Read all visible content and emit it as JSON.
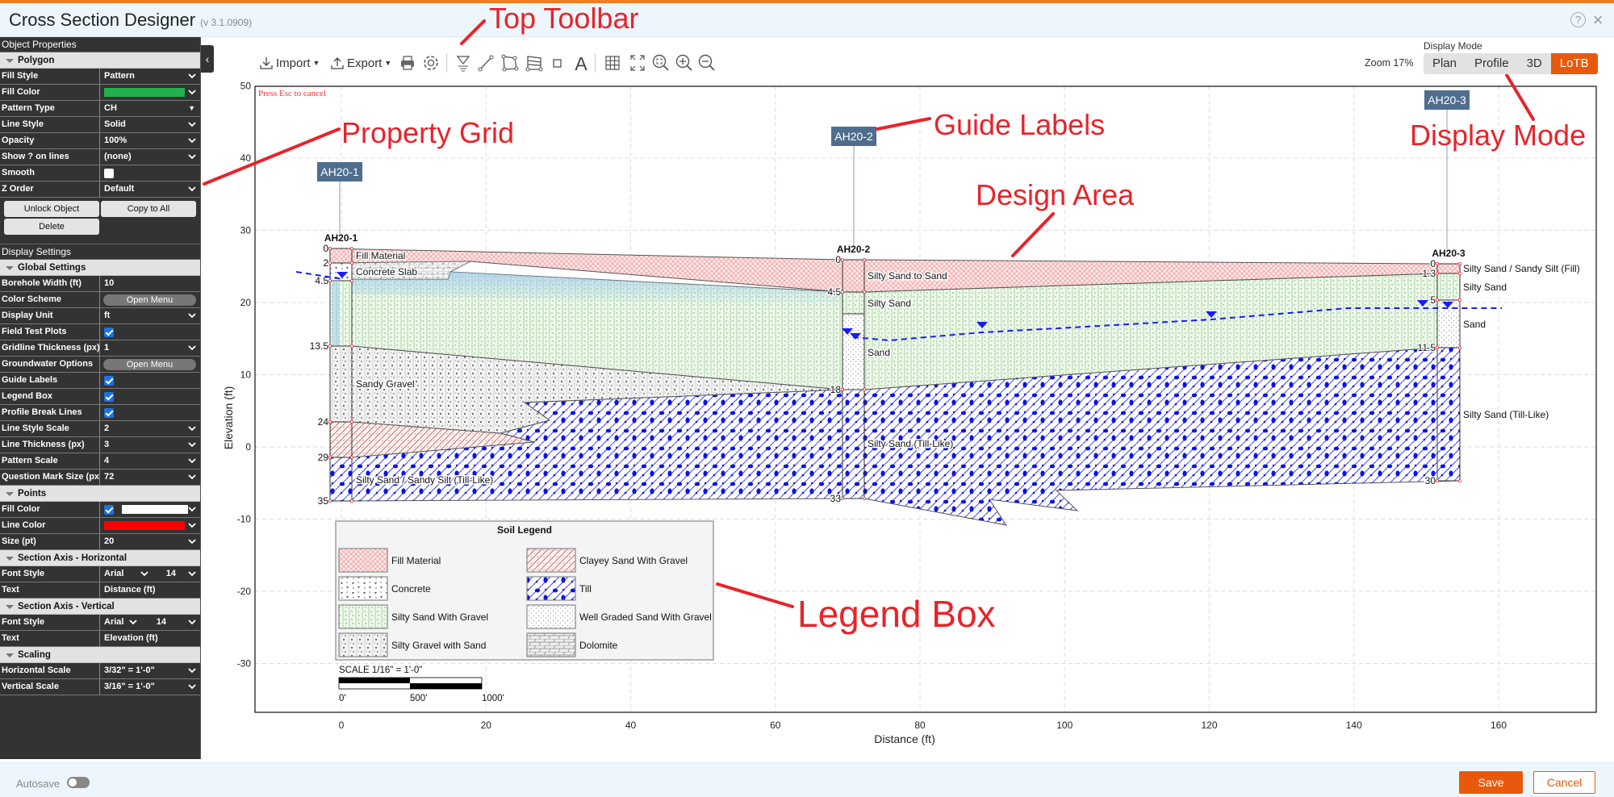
{
  "app": {
    "title": "Cross Section Designer",
    "version": "(v 3.1.0909)"
  },
  "header_icons": [
    "help-icon",
    "close-icon"
  ],
  "sidebar": {
    "sections": [
      {
        "header": "Object Properties"
      },
      {
        "group": "Polygon",
        "rows": [
          {
            "label": "Fill Style",
            "type": "select",
            "value": "Pattern"
          },
          {
            "label": "Fill Color",
            "type": "color",
            "color": "#22b14c"
          },
          {
            "label": "Pattern Type",
            "type": "caret",
            "value": "CH"
          },
          {
            "label": "Line Style",
            "type": "select",
            "value": "Solid"
          },
          {
            "label": "Opacity",
            "type": "select",
            "value": "100%"
          },
          {
            "label": "Show ? on lines",
            "type": "select",
            "value": "(none)"
          },
          {
            "label": "Smooth",
            "type": "checkbox",
            "checked": false
          },
          {
            "label": "Z Order",
            "type": "select",
            "value": "Default"
          }
        ]
      },
      {
        "buttons": [
          "Unlock Object",
          "Copy to All",
          "Delete"
        ]
      },
      {
        "header": "Display Settings"
      },
      {
        "group": "Global Settings",
        "rows": [
          {
            "label": "Borehole Width (ft)",
            "type": "text",
            "value": "10"
          },
          {
            "label": "Color Scheme",
            "type": "button",
            "value": "Open Menu"
          },
          {
            "label": "Display Unit",
            "type": "select",
            "value": "ft"
          },
          {
            "label": "Field Test Plots",
            "type": "checkbox",
            "checked": true
          },
          {
            "label": "Gridline Thickness (px)",
            "type": "select",
            "value": "1"
          },
          {
            "label": "Groundwater Options",
            "type": "button",
            "value": "Open Menu"
          },
          {
            "label": "Guide Labels",
            "type": "checkbox",
            "checked": true
          },
          {
            "label": "Legend Box",
            "type": "checkbox",
            "checked": true
          },
          {
            "label": "Profile Break Lines",
            "type": "checkbox",
            "checked": true
          },
          {
            "label": "Line Style Scale",
            "type": "select",
            "value": "2"
          },
          {
            "label": "Line Thickness (px)",
            "type": "select",
            "value": "3"
          },
          {
            "label": "Pattern Scale",
            "type": "select",
            "value": "4"
          },
          {
            "label": "Question Mark Size (px)",
            "type": "select",
            "value": "72"
          }
        ]
      },
      {
        "group": "Points",
        "rows": [
          {
            "label": "Fill Color",
            "type": "checkcolor",
            "checked": true,
            "color": "#ffffff"
          },
          {
            "label": "Line Color",
            "type": "color",
            "color": "#ff0000"
          },
          {
            "label": "Size (pt)",
            "type": "select",
            "value": "20"
          }
        ]
      },
      {
        "group": "Section Axis - Horizontal",
        "rows": [
          {
            "label": "Font Style",
            "type": "font",
            "value": "Arial",
            "size": "14"
          },
          {
            "label": "Text",
            "type": "text",
            "value": "Distance (ft)"
          }
        ]
      },
      {
        "group": "Section Axis - Vertical",
        "rows": [
          {
            "label": "Font Style",
            "type": "font",
            "value": "Arial",
            "size": "14"
          },
          {
            "label": "Text",
            "type": "text",
            "value": "Elevation (ft)"
          }
        ]
      },
      {
        "group": "Scaling",
        "rows": [
          {
            "label": "Horizontal Scale",
            "type": "select",
            "value": "3/32\" = 1'-0\""
          },
          {
            "label": "Vertical Scale",
            "type": "select",
            "value": "3/16\" = 1'-0\""
          }
        ]
      }
    ]
  },
  "toolbar": {
    "import_label": "Import",
    "export_label": "Export",
    "tools": [
      "print-icon",
      "settings-gear-icon",
      "groundwater-tool-icon",
      "line-tool-icon",
      "polygon-tool-icon",
      "layers-tool-icon",
      "rectangle-tool-icon",
      "text-tool-icon",
      "grid-icon",
      "fit-screen-icon",
      "zoom-extents-icon",
      "zoom-in-icon",
      "zoom-out-icon"
    ]
  },
  "zoom": "Zoom 17%",
  "display_mode": {
    "label": "Display Mode",
    "options": [
      "Plan",
      "Profile",
      "3D",
      "LoTB"
    ],
    "active": "LoTB",
    "accent": "#e8590c"
  },
  "design_area": {
    "notice": "Press Esc to cancel",
    "x_axis": {
      "label": "Distance (ft)",
      "ticks": [
        0,
        20,
        40,
        60,
        80,
        100,
        120,
        140,
        160
      ]
    },
    "y_axis": {
      "label": "Elevation (ft)",
      "ticks": [
        50,
        40,
        30,
        20,
        10,
        0,
        -10,
        -20,
        -30
      ]
    },
    "boreholes": [
      {
        "name": "AH20-1",
        "guide_label": "AH20-1",
        "depths": [
          "0",
          "2",
          "4.5",
          "13.5",
          "24",
          "29",
          "35"
        ],
        "layers": [
          "Fill Material",
          "Concrete Slab",
          "Sandy Gravel",
          "Silty Sand / Sandy Silt (Till-Like)"
        ]
      },
      {
        "name": "AH20-2",
        "guide_label": "AH20-2",
        "depths": [
          "0",
          "4.5",
          "18",
          "33"
        ],
        "layers": [
          "Silty Sand to Sand",
          "Silty Sand",
          "Sand",
          "Silty Sand (Till-Like)"
        ]
      },
      {
        "name": "AH20-3",
        "guide_label": "AH20-3",
        "depths": [
          "0",
          "1.3",
          "5",
          "11.5",
          "30"
        ],
        "layers": [
          "Silty Sand / Sandy Silt (Fill)",
          "Silty Sand",
          "Sand",
          "Silty Sand (Till-Like)"
        ]
      }
    ],
    "groundwater_color": "#1a1aff",
    "legend": {
      "title": "Soil Legend",
      "items": [
        {
          "name": "Fill Material",
          "pattern": "fill"
        },
        {
          "name": "Clayey Sand With Gravel",
          "pattern": "clay"
        },
        {
          "name": "Concrete",
          "pattern": "concrete"
        },
        {
          "name": "Till",
          "pattern": "till"
        },
        {
          "name": "Silty Sand With Gravel",
          "pattern": "ssg"
        },
        {
          "name": "Well Graded Sand With Gravel",
          "pattern": "wgs"
        },
        {
          "name": "Silty Gravel with Sand",
          "pattern": "sgs"
        },
        {
          "name": "Dolomite",
          "pattern": "dolo"
        }
      ]
    },
    "scale_bar": {
      "text": "SCALE 1/16\" = 1'-0\"",
      "labels": [
        "0'",
        "500'",
        "1000'"
      ]
    }
  },
  "annotations": {
    "top_toolbar": "Top Toolbar",
    "property_grid": "Property Grid",
    "guide_labels": "Guide Labels",
    "display_mode": "Display Mode",
    "design_area": "Design Area",
    "legend_box": "Legend Box",
    "color": "#e8232a"
  },
  "footer": {
    "autosave": "Autosave",
    "autosave_on": false,
    "save": "Save",
    "cancel": "Cancel"
  }
}
